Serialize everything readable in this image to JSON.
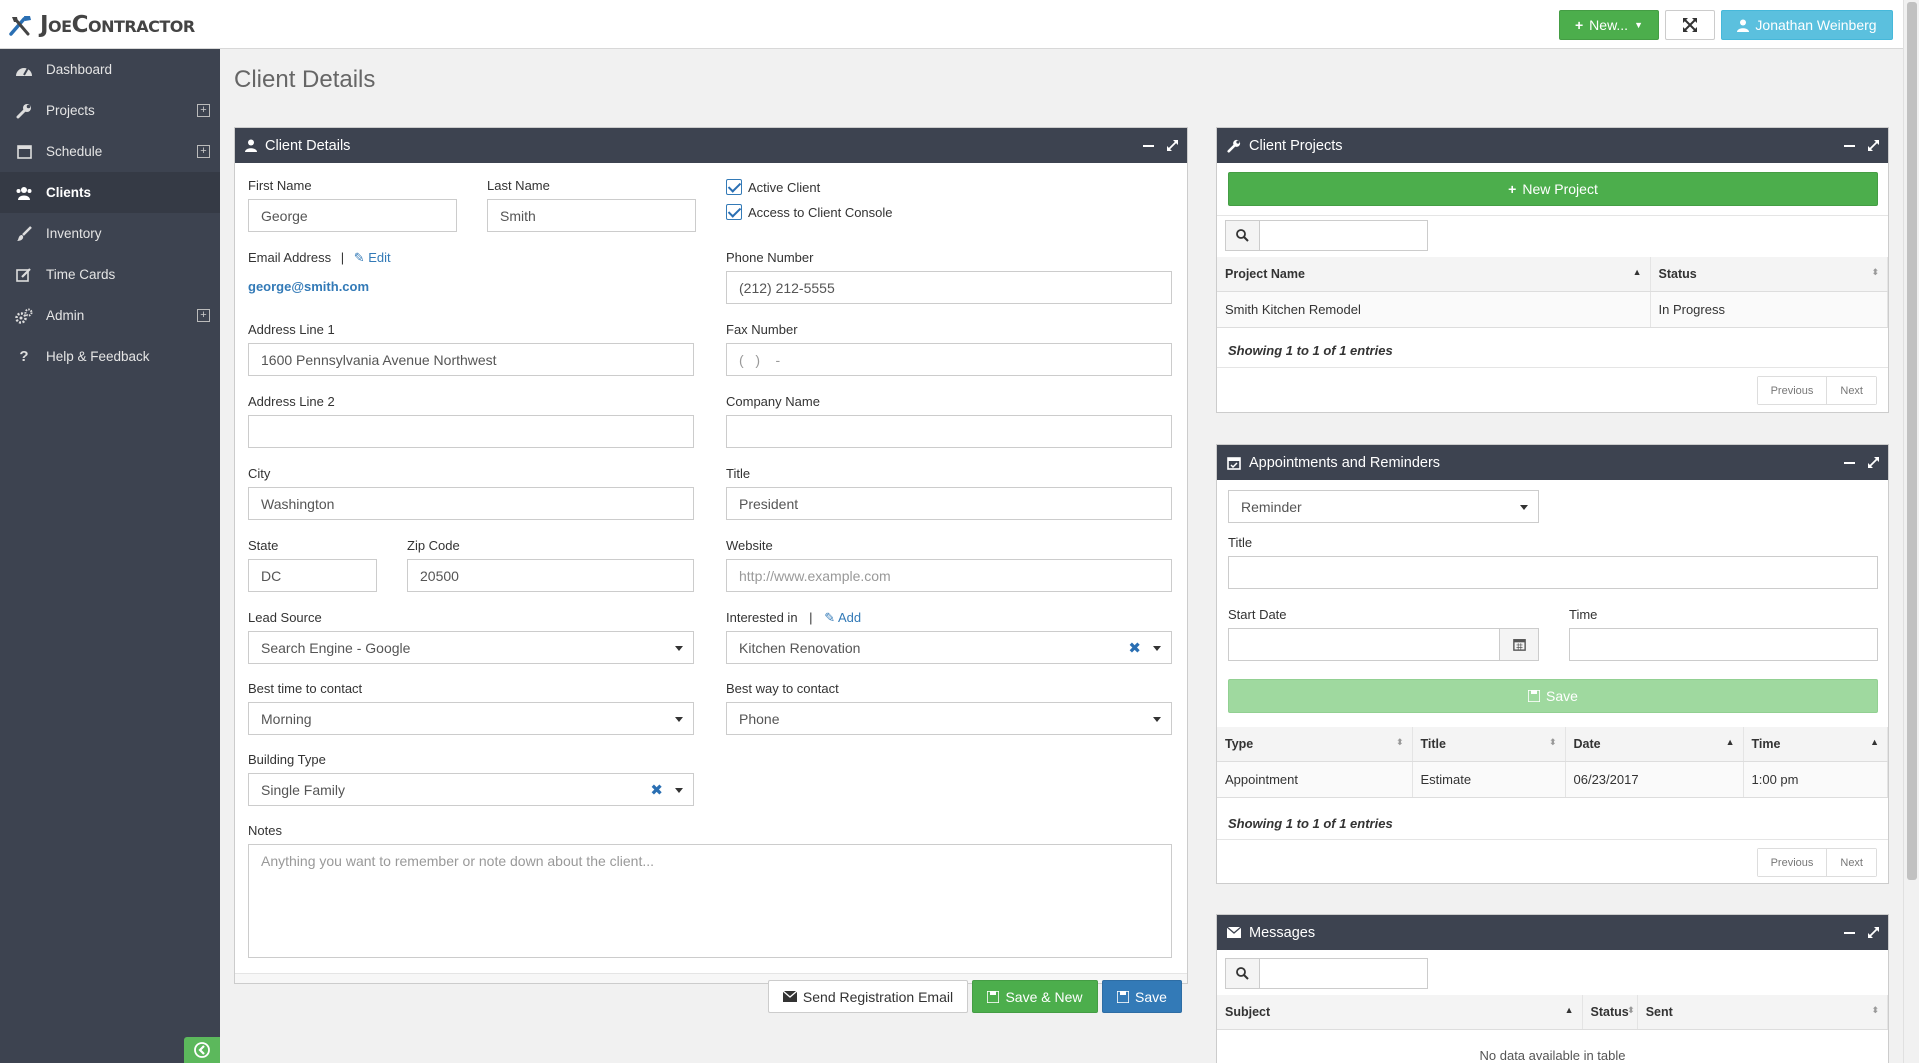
{
  "app": {
    "logo": "JoeContractor"
  },
  "topbar": {
    "new_label": "New...",
    "user_label": "Jonathan Weinberg"
  },
  "sidebar": {
    "items": [
      {
        "label": "Dashboard",
        "icon": "dashboard-icon"
      },
      {
        "label": "Projects",
        "icon": "wrench-icon",
        "expand": "+"
      },
      {
        "label": "Schedule",
        "icon": "calendar-icon",
        "expand": "+"
      },
      {
        "label": "Clients",
        "icon": "users-icon"
      },
      {
        "label": "Inventory",
        "icon": "brush-icon"
      },
      {
        "label": "Time Cards",
        "icon": "edit-icon"
      },
      {
        "label": "Admin",
        "icon": "cogs-icon",
        "expand": "+"
      },
      {
        "label": "Help & Feedback",
        "icon": "question-icon"
      }
    ]
  },
  "page": {
    "title": "Client Details"
  },
  "client_form": {
    "panel_title": "Client Details",
    "first_name": {
      "label": "First Name",
      "value": "George"
    },
    "last_name": {
      "label": "Last Name",
      "value": "Smith"
    },
    "active_client": "Active Client",
    "console_access": "Access to Client Console",
    "email": {
      "label": "Email Address",
      "separator": "|",
      "edit": "Edit",
      "value": "george@smith.com"
    },
    "phone": {
      "label": "Phone Number",
      "value": "(212) 212-5555"
    },
    "address1": {
      "label": "Address Line 1",
      "value": "1600 Pennsylvania Avenue Northwest"
    },
    "fax": {
      "label": "Fax Number",
      "placeholder": "(   )    -"
    },
    "address2": {
      "label": "Address Line 2",
      "value": ""
    },
    "company": {
      "label": "Company Name",
      "value": ""
    },
    "city": {
      "label": "City",
      "value": "Washington"
    },
    "title": {
      "label": "Title",
      "value": "President"
    },
    "state": {
      "label": "State",
      "value": "DC"
    },
    "zip": {
      "label": "Zip Code",
      "value": "20500"
    },
    "website": {
      "label": "Website",
      "placeholder": "http://www.example.com"
    },
    "lead_source": {
      "label": "Lead Source",
      "value": "Search Engine - Google"
    },
    "interested": {
      "label": "Interested in",
      "separator": "|",
      "add": "Add",
      "value": "Kitchen Renovation"
    },
    "best_time": {
      "label": "Best time to contact",
      "value": "Morning"
    },
    "best_way": {
      "label": "Best way to contact",
      "value": "Phone"
    },
    "building": {
      "label": "Building Type",
      "value": "Single Family"
    },
    "notes": {
      "label": "Notes",
      "placeholder": "Anything you want to remember or note down about the client..."
    },
    "buttons": {
      "send": "Send Registration Email",
      "save_new": "Save & New",
      "save": "Save"
    }
  },
  "projects": {
    "panel_title": "Client Projects",
    "new_project": "New Project",
    "columns": [
      "Project Name",
      "Status"
    ],
    "rows": [
      [
        "Smith Kitchen Remodel",
        "In Progress"
      ]
    ],
    "showing": "Showing 1 to 1 of 1 entries",
    "prev": "Previous",
    "next": "Next"
  },
  "appointments": {
    "panel_title": "Appointments and Reminders",
    "type_value": "Reminder",
    "title_label": "Title",
    "start_label": "Start Date",
    "time_label": "Time",
    "save": "Save",
    "columns": [
      "Type",
      "Title",
      "Date",
      "Time"
    ],
    "rows": [
      [
        "Appointment",
        "Estimate",
        "06/23/2017",
        "1:00 pm"
      ]
    ],
    "showing": "Showing 1 to 1 of 1 entries",
    "prev": "Previous",
    "next": "Next"
  },
  "messages": {
    "panel_title": "Messages",
    "columns": [
      "Subject",
      "Status",
      "Sent"
    ],
    "empty": "No data available in table"
  }
}
